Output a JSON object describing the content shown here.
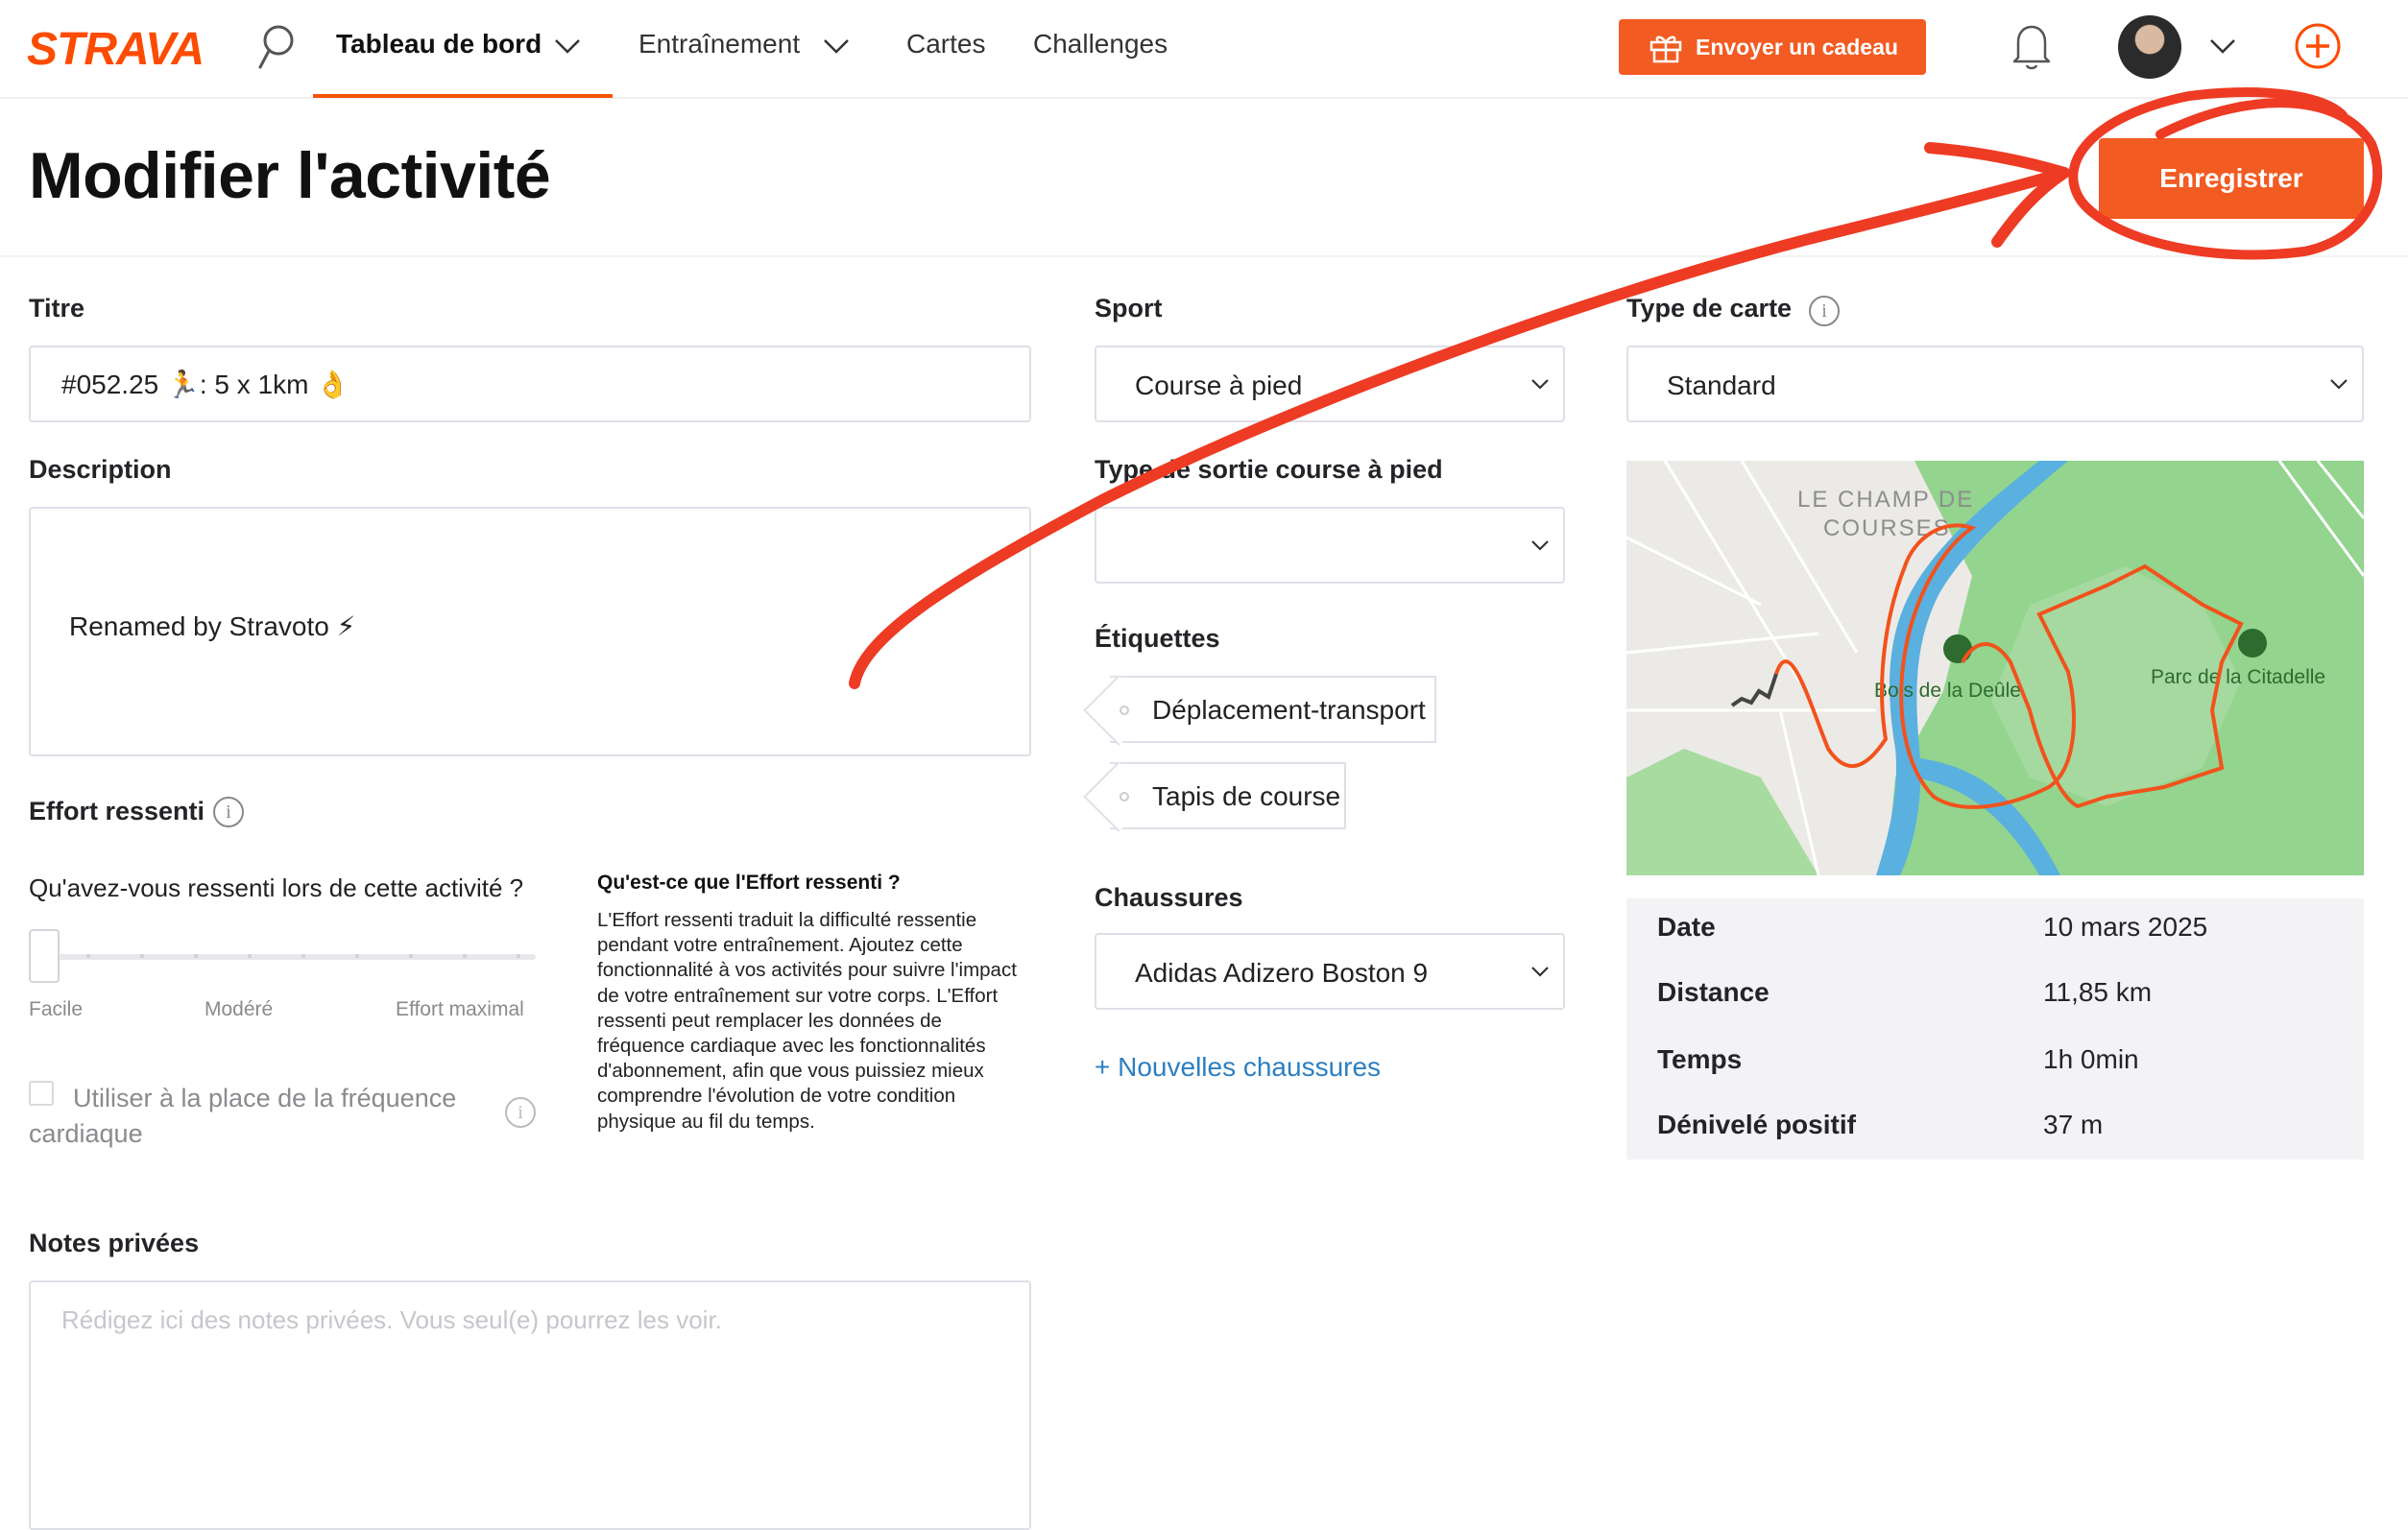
{
  "nav": {
    "logo": "STRAVA",
    "items": [
      "Tableau de bord",
      "Entraînement",
      "Cartes",
      "Challenges"
    ],
    "gift_button": "Envoyer un cadeau"
  },
  "page": {
    "title": "Modifier l'activité",
    "save_button": "Enregistrer"
  },
  "form": {
    "title_label": "Titre",
    "title_value": "#052.25 🏃: 5 x 1km 👌",
    "description_label": "Description",
    "description_value": "Renamed by Stravoto ⚡",
    "effort_label": "Effort ressenti",
    "effort_question": "Qu'avez-vous ressenti lors de cette activité ?",
    "effort_scale": [
      "Facile",
      "Modéré",
      "Effort maximal"
    ],
    "effort_level": 0,
    "rpe_heading": "Qu'est-ce que l'Effort ressenti ?",
    "rpe_body": "L'Effort ressenti traduit la difficulté ressentie pendant votre entraînement. Ajoutez cette fonctionnalité à vos activités pour suivre l'impact de votre entraînement sur votre corps. L'Effort ressenti peut remplacer les données de fréquence cardiaque avec les fonctionnalités d'abonnement, afin que vous puissiez mieux comprendre l'évolution de votre condition physique au fil du temps.",
    "hr_checkbox_label": "Utiliser à la place de la fréquence cardiaque",
    "hr_checkbox_checked": false,
    "private_notes_label": "Notes privées",
    "private_notes_placeholder": "Rédigez ici des notes privées. Vous seul(e) pourrez les voir.",
    "sport_label": "Sport",
    "sport_value": "Course à pied",
    "run_type_label": "Type de sortie course à pied",
    "run_type_value": "",
    "tags_label": "Étiquettes",
    "tags": [
      "Déplacement-transport",
      "Tapis de course"
    ],
    "shoes_label": "Chaussures",
    "shoes_value": "Adidas Adizero Boston 9",
    "new_shoes_link": "+ Nouvelles chaussures",
    "map_type_label": "Type de carte",
    "map_type_value": "Standard"
  },
  "map": {
    "labels": [
      "LE CHAMP DE",
      "COURSES",
      "Bois de la Deûle",
      "Parc de la Citadelle"
    ]
  },
  "stats": [
    {
      "label": "Date",
      "value": "10 mars 2025"
    },
    {
      "label": "Distance",
      "value": "11,85 km"
    },
    {
      "label": "Temps",
      "value": "1h 0min"
    },
    {
      "label": "Dénivelé positif",
      "value": "37 m"
    }
  ],
  "colors": {
    "brand": "#fc4c02",
    "button": "#f25b22",
    "link": "#2d7fc1",
    "annotation": "#ee3b24",
    "map_park": "#8fd18c",
    "map_water": "#4aa3d8"
  }
}
